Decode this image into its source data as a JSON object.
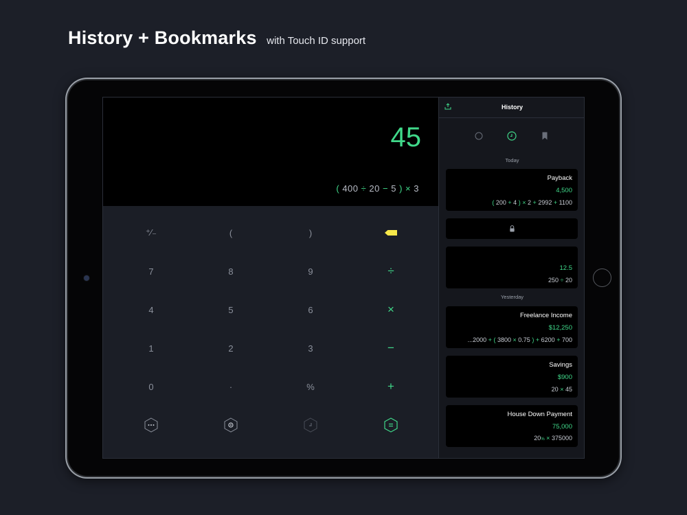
{
  "headline": {
    "title": "History + Bookmarks",
    "subtitle": "with Touch ID support"
  },
  "colors": {
    "accent": "#40d98a",
    "backspace": "#f7e84a",
    "background": "#1c1f28",
    "display": "#000000"
  },
  "calculator": {
    "result": "45",
    "expression": {
      "open": "(",
      "a": "400",
      "op1": "÷",
      "b": "20",
      "op2": "−",
      "c": "5",
      "close": ")",
      "op3": "×",
      "d": "3"
    },
    "keys": {
      "plus_minus": "⁺∕₋",
      "open_paren": "(",
      "close_paren": ")",
      "seven": "7",
      "eight": "8",
      "nine": "9",
      "divide": "÷",
      "four": "4",
      "five": "5",
      "six": "6",
      "multiply": "×",
      "one": "1",
      "two": "2",
      "three": "3",
      "minus": "−",
      "zero": "0",
      "dot": "·",
      "percent": "%",
      "plus": "+"
    },
    "bottom_icons": [
      "more-icon",
      "settings-icon",
      "history-icon",
      "equals-icon"
    ],
    "equals_label": "="
  },
  "history": {
    "title": "History",
    "tabs": [
      "circle-icon",
      "clock-icon",
      "bookmark-icon"
    ],
    "sections": {
      "today": "Today",
      "yesterday": "Yesterday"
    },
    "cards": {
      "payback": {
        "title": "Payback",
        "value": "4,500",
        "expr": [
          "(",
          "200",
          "+",
          "4",
          ")",
          "×",
          "2",
          "+",
          "2992",
          "+",
          "1100"
        ]
      },
      "locked": {
        "icon": "lock-icon"
      },
      "untitled": {
        "value": "12.5",
        "expr": [
          "250",
          "÷",
          "20"
        ]
      },
      "freelance": {
        "title": "Freelance Income",
        "value": "$12,250",
        "expr": [
          "...2000",
          "+",
          "(",
          "3800",
          "×",
          "0.75",
          ")",
          "+",
          "6200",
          "+",
          "700"
        ]
      },
      "savings": {
        "title": "Savings",
        "value": "$900",
        "expr": [
          "20",
          "×",
          "45"
        ]
      },
      "house": {
        "title": "House Down Payment",
        "value": "75,000",
        "expr": [
          "20",
          "%",
          "×",
          "375000"
        ]
      }
    }
  }
}
